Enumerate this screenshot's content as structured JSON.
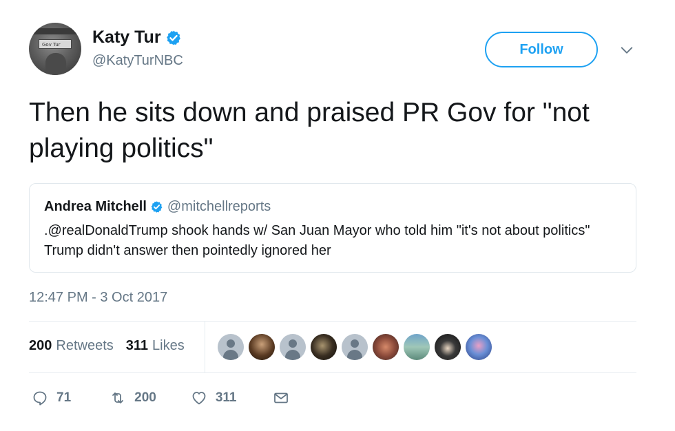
{
  "author": {
    "name": "Katy Tur",
    "handle": "@KatyTurNBC",
    "avatar_sign_text": "Gov Tur"
  },
  "follow_button": {
    "label": "Follow"
  },
  "tweet": {
    "text": "Then he sits down and praised PR Gov for \"not playing politics\""
  },
  "quoted_tweet": {
    "name": "Andrea Mitchell",
    "handle": "@mitchellreports",
    "text": ".@realDonaldTrump shook hands w/ San Juan Mayor who told him \"it's not about politics\" Trump didn't answer then pointedly ignored her"
  },
  "timestamp": "12:47 PM - 3 Oct 2017",
  "stats": {
    "retweets_count": "200",
    "retweets_label": "Retweets",
    "likes_count": "311",
    "likes_label": "Likes"
  },
  "actions": {
    "reply_count": "71",
    "retweet_count": "200",
    "like_count": "311"
  },
  "colors": {
    "accent": "#1da1f2",
    "secondary_text": "#657786",
    "border": "#e1e8ed"
  },
  "icons": [
    "verified-badge-icon",
    "chevron-down-icon",
    "reply-icon",
    "retweet-icon",
    "heart-icon",
    "envelope-icon"
  ]
}
